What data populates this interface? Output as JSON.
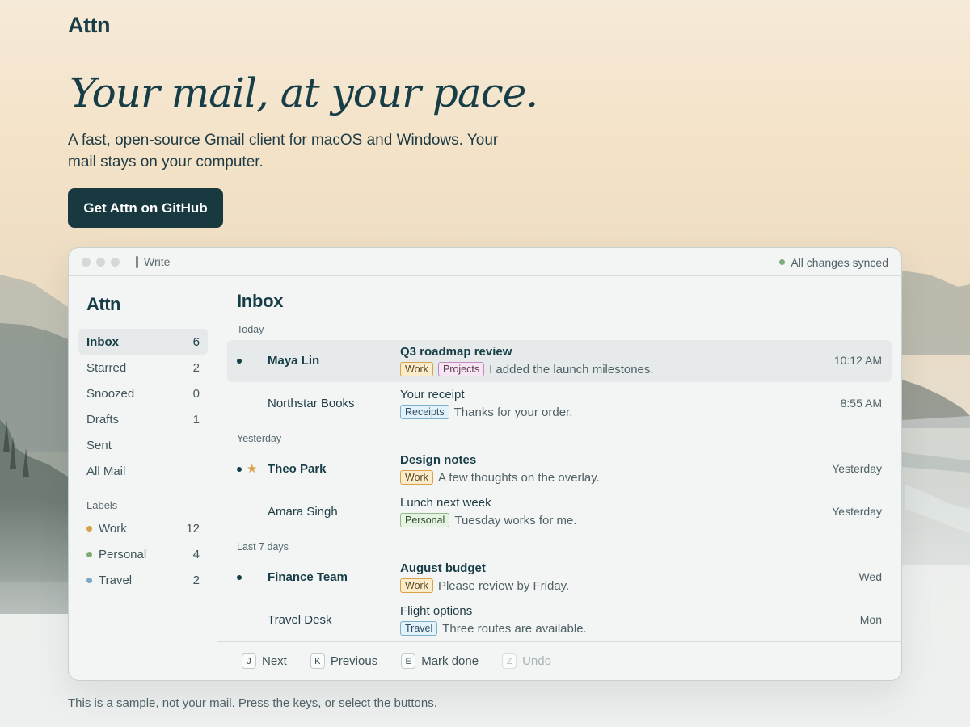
{
  "brand": "Attn",
  "hero": {
    "title": "Your mail, at your pace.",
    "subtitle": "A fast, open-source Gmail client for macOS and Windows. Your mail stays on your computer.",
    "cta": "Get Attn on GitHub"
  },
  "window": {
    "write_label": "Write",
    "sync_status": "All changes synced",
    "sidebar": {
      "brand": "Attn",
      "items": [
        {
          "label": "Inbox",
          "count": "6"
        },
        {
          "label": "Starred",
          "count": "2"
        },
        {
          "label": "Snoozed",
          "count": "0"
        },
        {
          "label": "Drafts",
          "count": "1"
        },
        {
          "label": "Sent",
          "count": ""
        },
        {
          "label": "All Mail",
          "count": ""
        }
      ],
      "labels_heading": "Labels",
      "labels": [
        {
          "label": "Work",
          "count": "12",
          "color": "#d4a24a"
        },
        {
          "label": "Personal",
          "count": "4",
          "color": "#7dab74"
        },
        {
          "label": "Travel",
          "count": "2",
          "color": "#7ea8c8"
        }
      ]
    },
    "inbox": {
      "title": "Inbox",
      "groups": [
        {
          "heading": "Today"
        },
        {
          "heading": "Yesterday"
        },
        {
          "heading": "Last 7 days"
        }
      ],
      "messages": [
        {
          "sender": "Maya Lin",
          "subject": "Q3 roadmap review",
          "tags": [
            "Work",
            "Projects"
          ],
          "preview": "I added the launch milestones.",
          "time": "10:12 AM"
        },
        {
          "sender": "Northstar Books",
          "subject": "Your receipt",
          "tags": [
            "Receipts"
          ],
          "preview": "Thanks for your order.",
          "time": "8:55 AM"
        },
        {
          "sender": "Theo Park",
          "subject": "Design notes",
          "tags": [
            "Work"
          ],
          "preview": "A few thoughts on the overlay.",
          "time": "Yesterday"
        },
        {
          "sender": "Amara Singh",
          "subject": "Lunch next week",
          "tags": [
            "Personal"
          ],
          "preview": "Tuesday works for me.",
          "time": "Yesterday"
        },
        {
          "sender": "Finance Team",
          "subject": "August budget",
          "tags": [
            "Work"
          ],
          "preview": "Please review by Friday.",
          "time": "Wed"
        },
        {
          "sender": "Travel Desk",
          "subject": "Flight options",
          "tags": [
            "Travel"
          ],
          "preview": "Three routes are available.",
          "time": "Mon"
        }
      ]
    },
    "shortcuts": [
      {
        "key": "J",
        "label": "Next"
      },
      {
        "key": "K",
        "label": "Previous"
      },
      {
        "key": "E",
        "label": "Mark done"
      },
      {
        "key": "Z",
        "label": "Undo"
      }
    ]
  },
  "note": "This is a sample, not your mail. Press the keys, or select the buttons."
}
